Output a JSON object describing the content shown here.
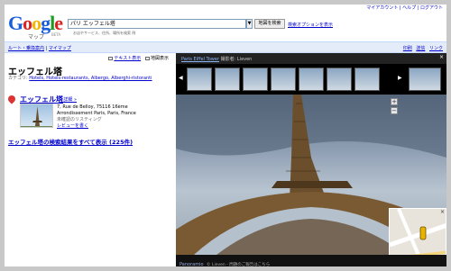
{
  "topnav": {
    "left_text": "",
    "right_text": "マイアカウント | ヘルプ | ログアウト"
  },
  "header": {
    "logo_text": "Google",
    "logo_sub": "マップ",
    "logo_beta": "BETA",
    "search_value": "パリ エッフェル塔",
    "search_button": "地図を検索",
    "search_options": "検索オプションを表示",
    "hint": "お店やサービス、住所、場所を検索 例"
  },
  "toolbar": {
    "route_link": "ルート・乗換案内",
    "mymap_link": "マイマップ",
    "print": "印刷",
    "send": "送信",
    "link": "リンク"
  },
  "left": {
    "text_view": "テキスト表示",
    "map_view": "地図表示",
    "title": "エッフェル塔",
    "category_label": "カテゴリ:",
    "category_links": "Hotels, Hotels-restaurants, Albergo, Alberghi-ristoranti",
    "place_name": "エッフェル塔",
    "place_detail": "- 詳細 »",
    "address_line1": "7, Rue de Belloy, 75116 16ème",
    "address_line2": "Arrondissement Paris, Paris, France",
    "unlisted": "未確認のリスティング",
    "write_review": "レビューを書く",
    "all_results": "エッフェル塔の検索結果をすべて表示 (225件)"
  },
  "streetview": {
    "title_link": "Paris Eiffel Tower",
    "title_rest": "撮影者: Lieven",
    "close": "×",
    "prev": "◀",
    "next": "▶",
    "zoom_in": "+",
    "zoom_out": "−",
    "powered_by": "Panoramio",
    "report": "© Lieven - 問題のご報告はこちら"
  },
  "colors": {
    "g_blue": "#1a5ed9",
    "g_red": "#d8231e",
    "g_yellow": "#f2b70a",
    "g_green": "#1d9b26",
    "link": "#0000cc"
  }
}
